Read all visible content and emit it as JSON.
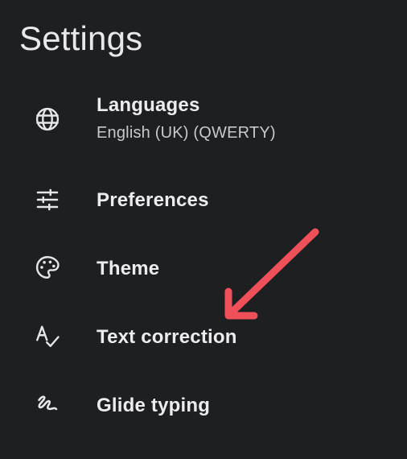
{
  "header": {
    "title": "Settings"
  },
  "menu": {
    "items": [
      {
        "label": "Languages",
        "sublabel": "English (UK) (QWERTY)",
        "icon": "globe-icon"
      },
      {
        "label": "Preferences",
        "icon": "tune-sliders-icon"
      },
      {
        "label": "Theme",
        "icon": "palette-icon"
      },
      {
        "label": "Text correction",
        "icon": "spellcheck-icon"
      },
      {
        "label": "Glide typing",
        "icon": "gesture-icon"
      }
    ]
  },
  "colors": {
    "background": "#1d1f21",
    "text": "#ececee",
    "subtext": "#c9c9cd",
    "annotation_arrow": "#f0505a"
  },
  "annotation": {
    "icon": "red-arrow-annotation",
    "points_to": "Text correction"
  }
}
